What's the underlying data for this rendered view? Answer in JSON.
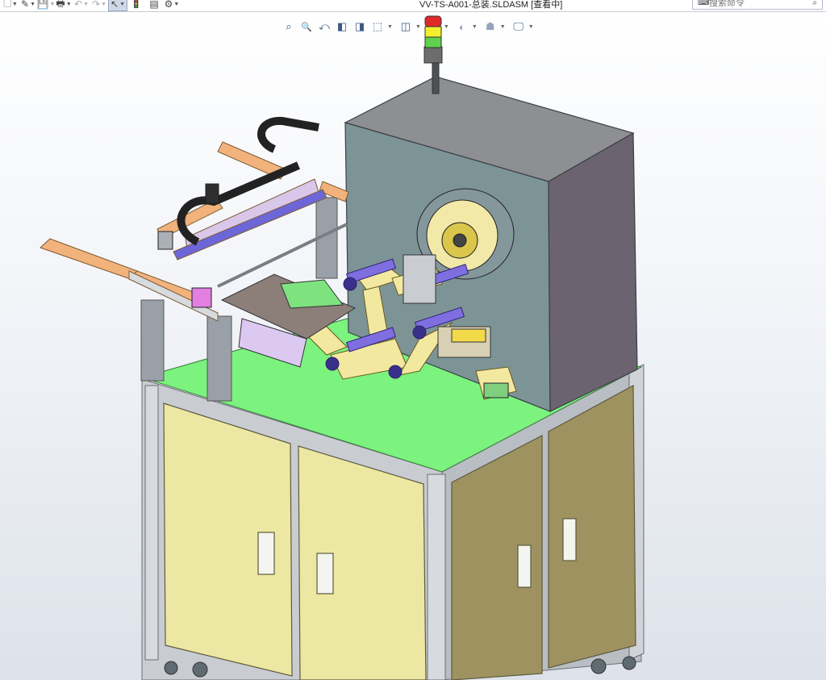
{
  "window": {
    "document_title": "VV-TS-A001-总装.SLDASM [查看中]"
  },
  "toolbar": {
    "buttons": [
      {
        "name": "new-document",
        "icon": "new-document-icon",
        "glyph": "🗋"
      },
      {
        "name": "open",
        "icon": "open-folder-icon",
        "glyph": "✎"
      },
      {
        "name": "save",
        "icon": "save-icon",
        "glyph": "💾"
      },
      {
        "name": "print",
        "icon": "print-icon",
        "glyph": "🖶"
      },
      {
        "name": "undo",
        "icon": "undo-icon",
        "glyph": "↶"
      },
      {
        "name": "redo",
        "icon": "redo-icon",
        "glyph": "↷"
      },
      {
        "name": "select",
        "icon": "cursor-icon",
        "glyph": "↖"
      },
      {
        "name": "traffic-light",
        "icon": "traffic-light-icon",
        "glyph": "🚦"
      },
      {
        "name": "file-properties",
        "icon": "file-properties-icon",
        "glyph": "▤"
      },
      {
        "name": "options",
        "icon": "gear-icon",
        "glyph": "⚙"
      }
    ]
  },
  "command_search": {
    "placeholder": "搜索命令",
    "icon": "command-search-icon",
    "search_icon": "search-icon"
  },
  "heads_up_toolbar": {
    "buttons": [
      {
        "name": "zoom-to-fit",
        "icon": "zoom-to-fit-icon",
        "glyph": "⌕"
      },
      {
        "name": "zoom-to-area",
        "icon": "zoom-area-icon",
        "glyph": "🔍"
      },
      {
        "name": "previous-view",
        "icon": "previous-view-icon",
        "glyph": "⤺"
      },
      {
        "name": "section-view",
        "icon": "section-view-icon",
        "glyph": "◧"
      },
      {
        "name": "dynamic-annotation",
        "icon": "annotation-view-icon",
        "glyph": "◨"
      },
      {
        "name": "view-orientation",
        "icon": "view-orientation-icon",
        "glyph": "⬚"
      },
      {
        "name": "display-style",
        "icon": "display-style-icon",
        "glyph": "◫"
      },
      {
        "name": "hide-show-items",
        "icon": "eye-icon",
        "glyph": "👁"
      },
      {
        "name": "edit-appearance",
        "icon": "appearance-icon",
        "glyph": "◐"
      },
      {
        "name": "apply-scene",
        "icon": "scene-icon",
        "glyph": "☗"
      },
      {
        "name": "view-settings",
        "icon": "monitor-icon",
        "glyph": "🖵"
      }
    ]
  },
  "colors": {
    "cabinet_door": "#ece8a3",
    "table_top": "#7cf27f",
    "box_front": "#7d9497",
    "box_side": "#6b6370",
    "box_top": "#8d8f93",
    "belt": "#f3e8a0",
    "roller": "#7f6ee0",
    "rail_orange": "#f2b27c",
    "rail_lilac": "#d9c7ea"
  }
}
